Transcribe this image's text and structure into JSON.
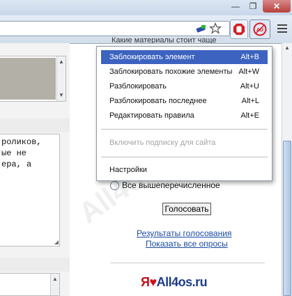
{
  "window": {
    "minimize_glyph": "—",
    "restore_glyph": "❐",
    "close_glyph": "✕"
  },
  "toolbar": {
    "icons": [
      "green-flag-icon",
      "star-icon",
      "stop-block-icon",
      "adblock-icon",
      "menu-icon"
    ]
  },
  "page": {
    "textarea_text": "роликов,\nые не\nера, а",
    "radio_label": "Все вышеперечисленное",
    "vote_button": "Голосовать",
    "results_link": "Результаты голосования",
    "all_polls_link": "Показать все опросы",
    "logo_ya": "Я",
    "logo_heart": "♥",
    "logo_text": "All4os.ru",
    "menu_peek": "Какие материалы стоит чаще"
  },
  "menu": {
    "items": [
      {
        "label": "Заблокировать элемент",
        "shortcut": "Alt+B"
      },
      {
        "label": "Заблокировать похожие элементы",
        "shortcut": "Alt+W"
      },
      {
        "label": "Разблокировать",
        "shortcut": "Alt+U"
      },
      {
        "label": "Разблокировать последнее",
        "shortcut": "Alt+L"
      },
      {
        "label": "Редактировать правила",
        "shortcut": "Alt+E"
      },
      {
        "label": "Включить подписку для сайта",
        "shortcut": ""
      },
      {
        "label": "Настройки",
        "shortcut": ""
      }
    ]
  },
  "watermark": "All4os.RU",
  "colors": {
    "menu_highlight": "#3d63c0",
    "link": "#1a4aa0",
    "adblock_red": "#d51f24"
  }
}
